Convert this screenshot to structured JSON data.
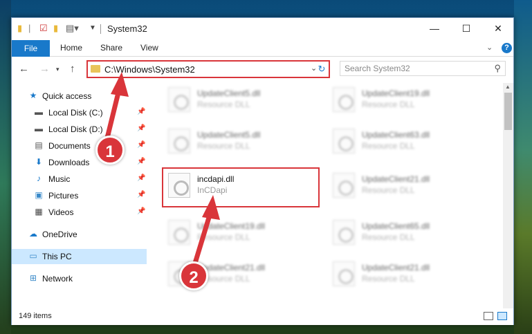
{
  "window": {
    "title": "System32"
  },
  "ribbon": {
    "file": "File",
    "tabs": [
      "Home",
      "Share",
      "View"
    ],
    "help": "?"
  },
  "address": {
    "path": "C:\\Windows\\System32"
  },
  "search": {
    "placeholder": "Search System32"
  },
  "navpane": {
    "items": [
      {
        "label": "Quick access",
        "icon": "star-icon",
        "pinned": false
      },
      {
        "label": "Local Disk (C:)",
        "icon": "drive-icon",
        "pinned": true
      },
      {
        "label": "Local Disk (D:)",
        "icon": "drive-icon",
        "pinned": true
      },
      {
        "label": "Documents",
        "icon": "document-icon",
        "pinned": true
      },
      {
        "label": "Downloads",
        "icon": "download-icon",
        "pinned": true
      },
      {
        "label": "Music",
        "icon": "music-icon",
        "pinned": true
      },
      {
        "label": "Pictures",
        "icon": "picture-icon",
        "pinned": true
      },
      {
        "label": "Videos",
        "icon": "video-icon",
        "pinned": true
      },
      {
        "label": "OneDrive",
        "icon": "cloud-icon",
        "pinned": false
      },
      {
        "label": "This PC",
        "icon": "computer-icon",
        "pinned": false,
        "selected": true
      },
      {
        "label": "Network",
        "icon": "network-icon",
        "pinned": false
      }
    ]
  },
  "files": {
    "items": [
      {
        "name": "UpdateClient5.dll",
        "desc": "Resource DLL",
        "blurred": true
      },
      {
        "name": "UpdateClient19.dll",
        "desc": "Resource DLL",
        "blurred": true
      },
      {
        "name": "UpdateClient5.dll",
        "desc": "Resource DLL",
        "blurred": true
      },
      {
        "name": "UpdateClient63.dll",
        "desc": "Resource DLL",
        "blurred": true
      },
      {
        "name": "incdapi.dll",
        "desc": "InCDapi",
        "blurred": false
      },
      {
        "name": "UpdateClient21.dll",
        "desc": "Resource DLL",
        "blurred": true
      },
      {
        "name": "UpdateClient19.dll",
        "desc": "Resource DLL",
        "blurred": true
      },
      {
        "name": "UpdateClient65.dll",
        "desc": "Resource DLL",
        "blurred": true
      },
      {
        "name": "UpdateClient21.dll",
        "desc": "Resource DLL",
        "blurred": true
      },
      {
        "name": "UpdateClient21.dll",
        "desc": "Resource DLL",
        "blurred": true
      }
    ]
  },
  "status": {
    "count": "149 items"
  },
  "annotations": {
    "step1": "1",
    "step2": "2",
    "color": "#d9353a"
  }
}
